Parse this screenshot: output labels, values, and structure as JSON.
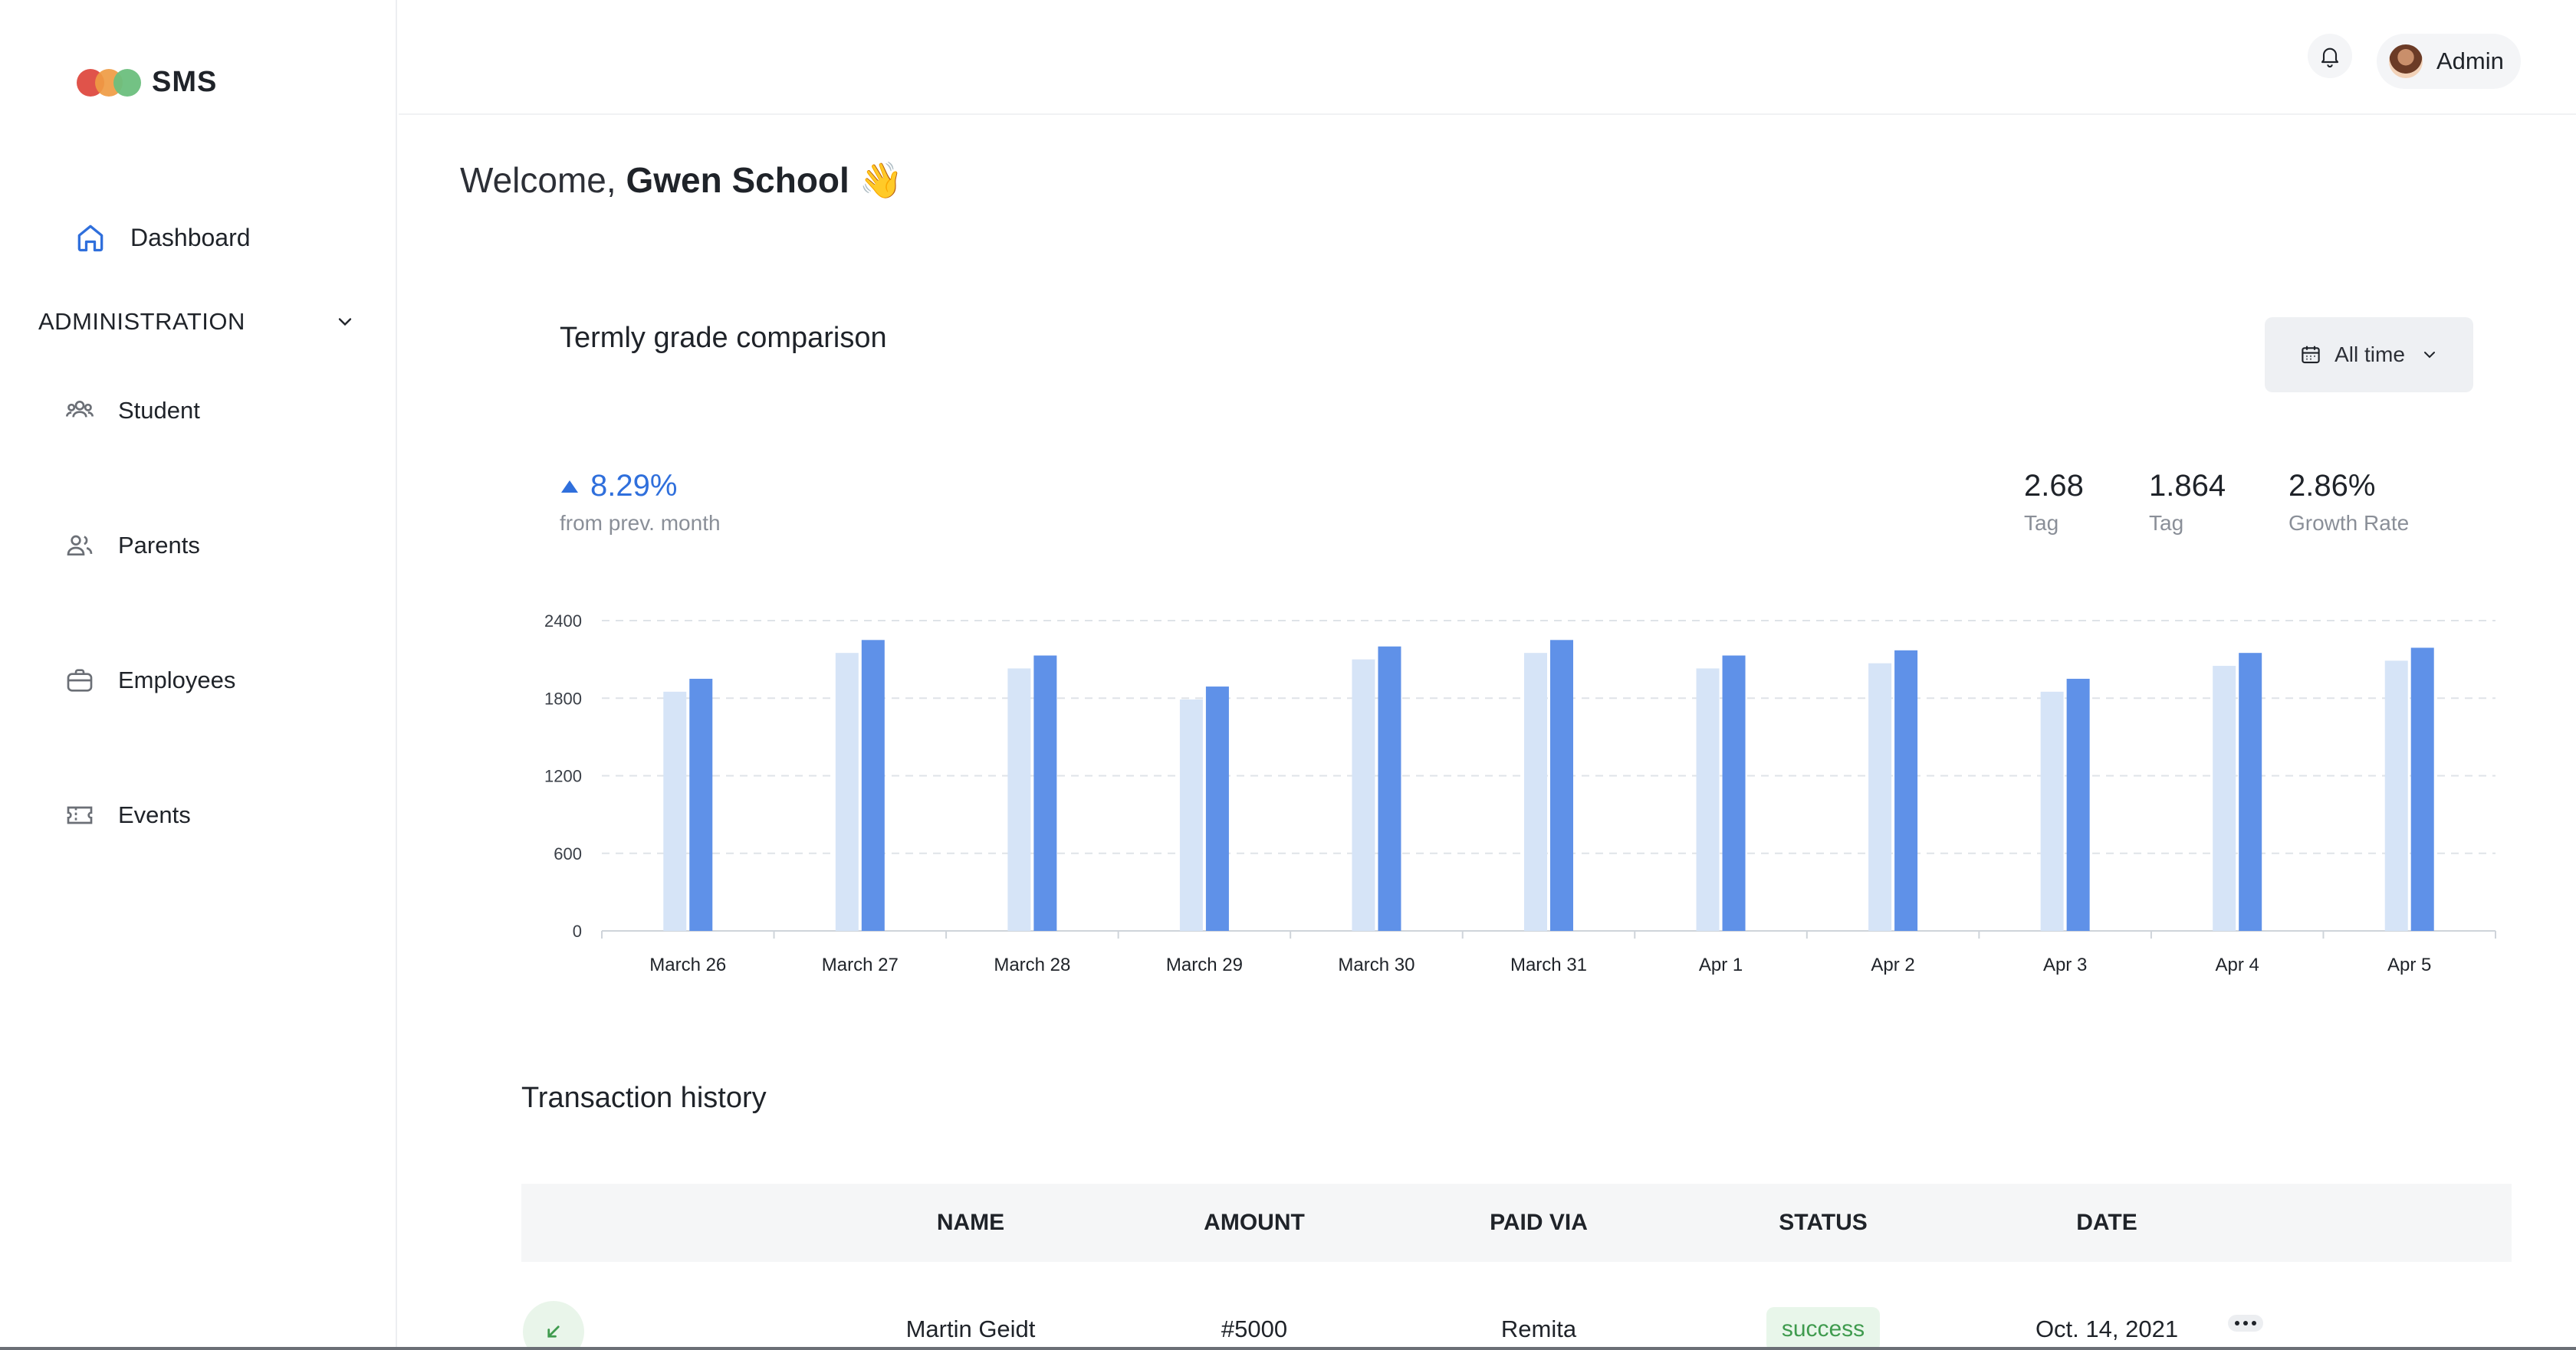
{
  "app": {
    "logo_text": "SMS"
  },
  "sidebar": {
    "dashboard_label": "Dashboard",
    "section_label": "ADMINISTRATION",
    "items": [
      {
        "label": "Student",
        "icon": "users-icon"
      },
      {
        "label": "Parents",
        "icon": "user-group-icon"
      },
      {
        "label": "Employees",
        "icon": "briefcase-icon"
      },
      {
        "label": "Events",
        "icon": "ticket-icon"
      }
    ]
  },
  "header": {
    "user_name": "Admin"
  },
  "welcome": {
    "prefix": "Welcome, ",
    "name": "Gwen School",
    "emoji": "👋"
  },
  "grade_card": {
    "title": "Termly grade comparison",
    "filter_label": "All time",
    "growth_value": "8.29%",
    "growth_caption": "from prev. month",
    "stats": [
      {
        "value": "2.68",
        "label": "Tag"
      },
      {
        "value": "1.864",
        "label": "Tag"
      },
      {
        "value": "2.86%",
        "label": "Growth Rate"
      }
    ]
  },
  "chart_data": {
    "type": "bar",
    "categories": [
      "March 26",
      "March 27",
      "March 28",
      "March 29",
      "March 30",
      "March 31",
      "Apr 1",
      "Apr 2",
      "Apr 3",
      "Apr 4",
      "Apr 5"
    ],
    "series": [
      {
        "values": [
          1850,
          2150,
          2030,
          1790,
          2100,
          2150,
          2030,
          2070,
          1850,
          2050,
          2090
        ],
        "color": "#d6e4f7"
      },
      {
        "values": [
          1950,
          2250,
          2130,
          1890,
          2200,
          2250,
          2130,
          2170,
          1950,
          2150,
          2190
        ],
        "color": "#5f91e8"
      }
    ],
    "yticks": [
      0,
      600,
      1200,
      1800,
      2400
    ],
    "ylim": [
      0,
      2400
    ],
    "grid": true
  },
  "transactions": {
    "title": "Transaction history",
    "columns": [
      "NAME",
      "AMOUNT",
      "PAID VIA",
      "STATUS",
      "DATE"
    ],
    "rows": [
      {
        "name": "Martin Geidt",
        "amount": "#5000",
        "paid_via": "Remita",
        "status": "success",
        "date": "Oct. 14, 2021"
      }
    ]
  }
}
